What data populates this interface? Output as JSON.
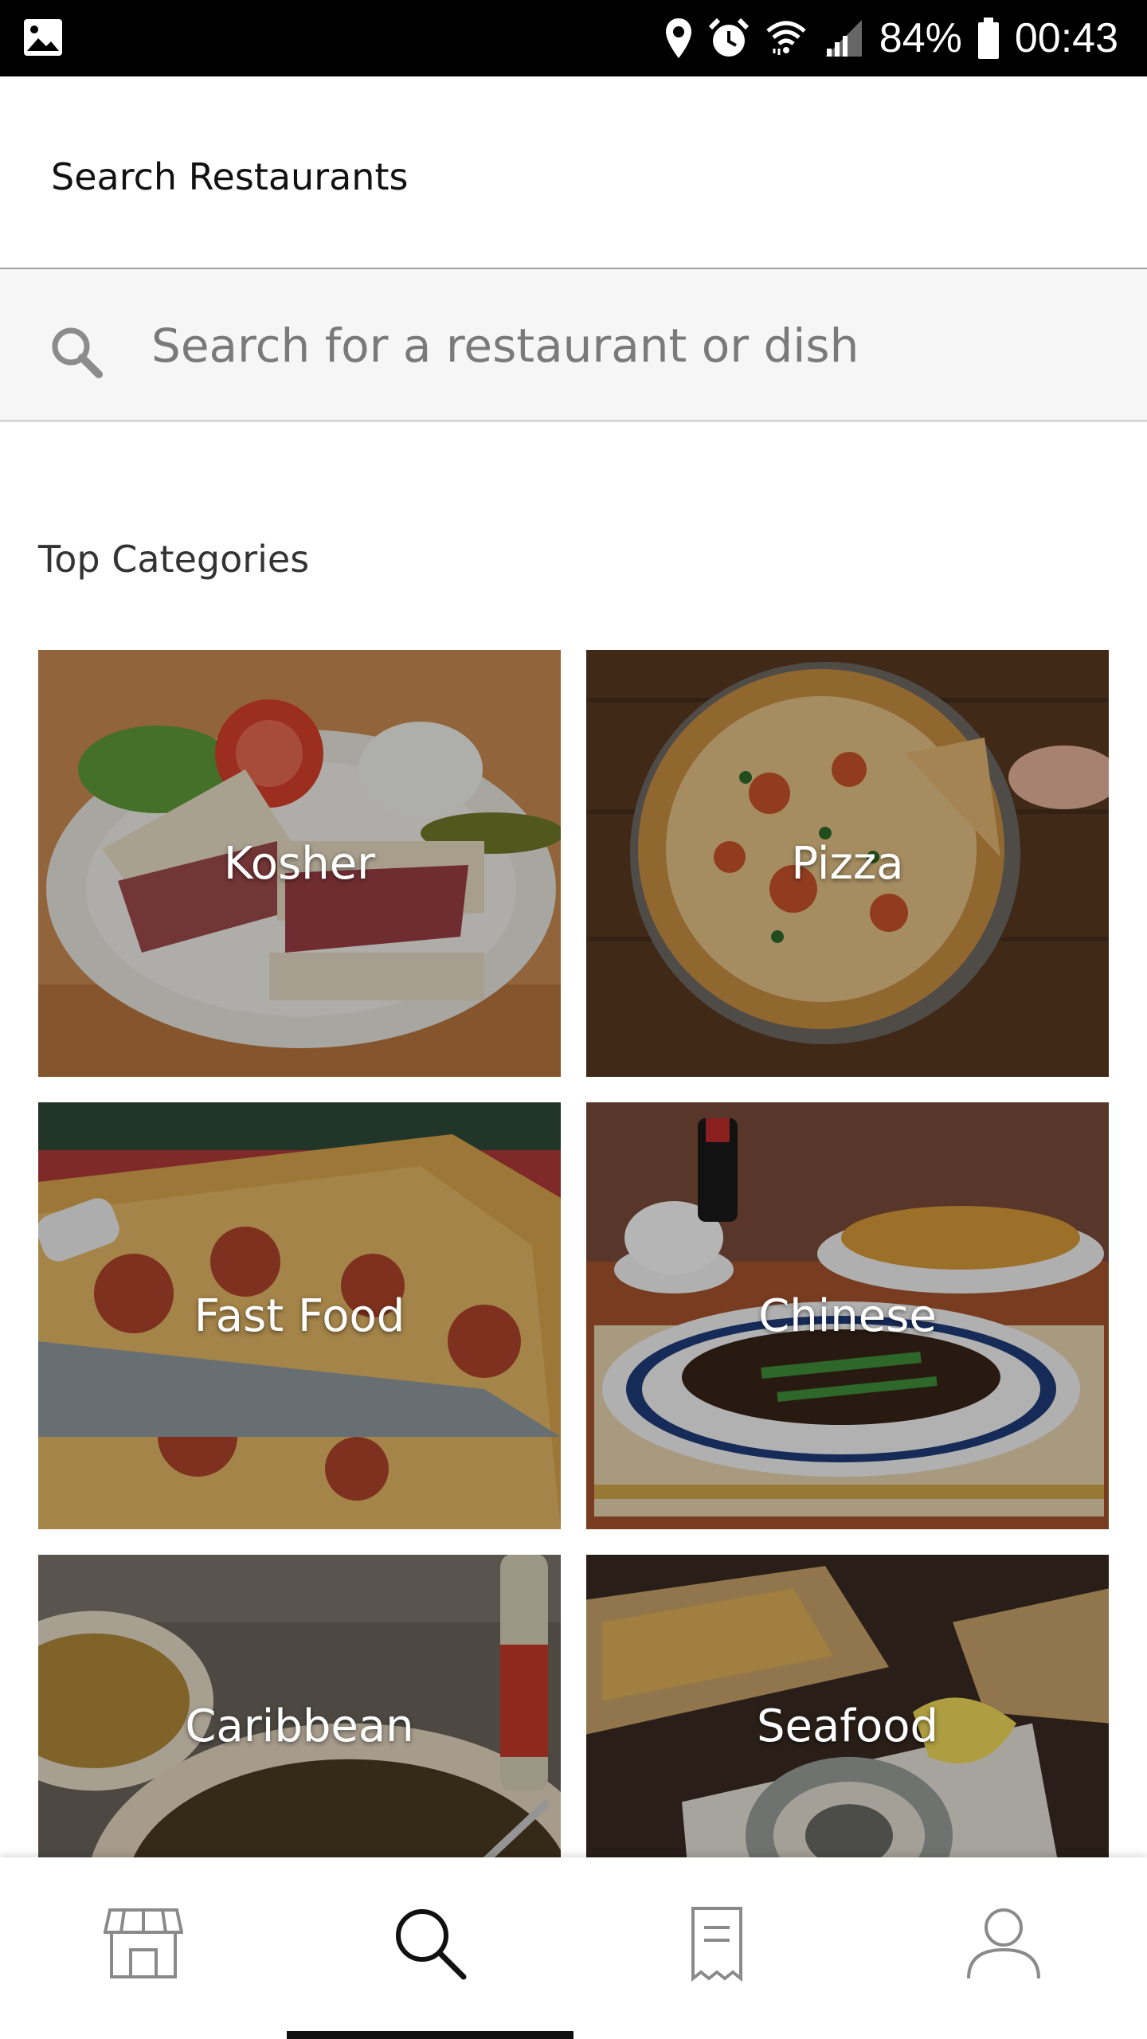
{
  "status_bar": {
    "battery": "84%",
    "time": "00:43",
    "icons": [
      "image-icon",
      "location-icon",
      "alarm-icon",
      "wifi-icon",
      "signal-icon",
      "battery-icon"
    ]
  },
  "header": {
    "title": "Search Restaurants"
  },
  "search": {
    "placeholder": "Search for a restaurant or dish",
    "value": "",
    "icon": "search-icon"
  },
  "categories": {
    "title": "Top Categories",
    "items": [
      {
        "label": "Kosher"
      },
      {
        "label": "Pizza"
      },
      {
        "label": "Fast Food"
      },
      {
        "label": "Chinese"
      },
      {
        "label": "Caribbean"
      },
      {
        "label": "Seafood"
      }
    ]
  },
  "bottom_nav": {
    "items": [
      {
        "icon": "storefront-icon",
        "active": false
      },
      {
        "icon": "search-icon",
        "active": true
      },
      {
        "icon": "receipt-icon",
        "active": false
      },
      {
        "icon": "profile-icon",
        "active": false
      }
    ]
  },
  "colors": {
    "status_bar": "#000000",
    "search_bg": "#f6f6f6",
    "accent": "#111111"
  }
}
